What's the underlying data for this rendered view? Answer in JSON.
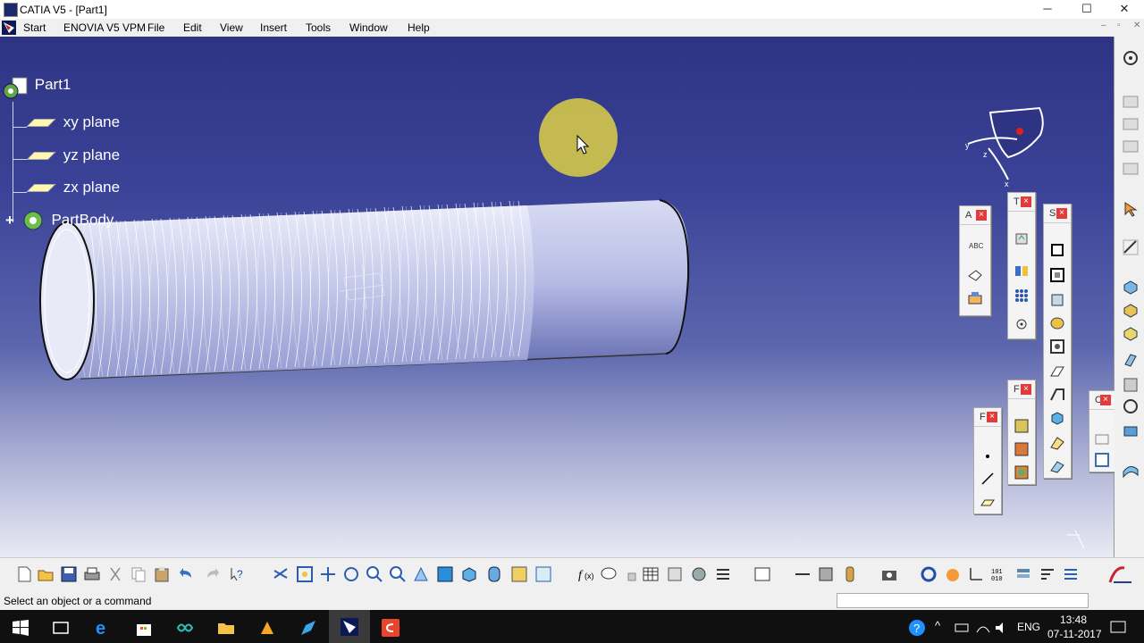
{
  "window": {
    "title": "CATIA V5 - [Part1]",
    "controls": {
      "minimize": "─",
      "maximize": "☐",
      "close": "✕"
    }
  },
  "menu": {
    "items": [
      "Start",
      "ENOVIA V5 VPM",
      "File",
      "Edit",
      "View",
      "Insert",
      "Tools",
      "Window",
      "Help"
    ],
    "doc_controls": [
      "–",
      "▫",
      "✕"
    ]
  },
  "tree": {
    "root": "Part1",
    "children": [
      "xy plane",
      "yz plane",
      "zx plane",
      "PartBody"
    ]
  },
  "compass": {
    "axes": [
      "y",
      "z",
      "x"
    ]
  },
  "toolbars": {
    "annotations": {
      "title": "A",
      "close": "×",
      "label": "ABC"
    },
    "tools": {
      "title": "T",
      "close": "×"
    },
    "sketch": {
      "title": "S",
      "close": "×"
    },
    "features": {
      "title": "F",
      "close": "×"
    },
    "reference": {
      "title": "F",
      "close": "×"
    },
    "constraint": {
      "title": "C",
      "close": "×"
    }
  },
  "status": {
    "message": "Select an object or a command"
  },
  "taskbar": {
    "time": "13:48",
    "date": "07-11-2017",
    "lang": "ENG"
  },
  "colors": {
    "viewport_top": "#2e3484",
    "viewport_bottom": "#e9eaf4",
    "cursor_halo": "#d4c84a",
    "close_red": "#e23b3b",
    "taskbar": "#101010"
  }
}
